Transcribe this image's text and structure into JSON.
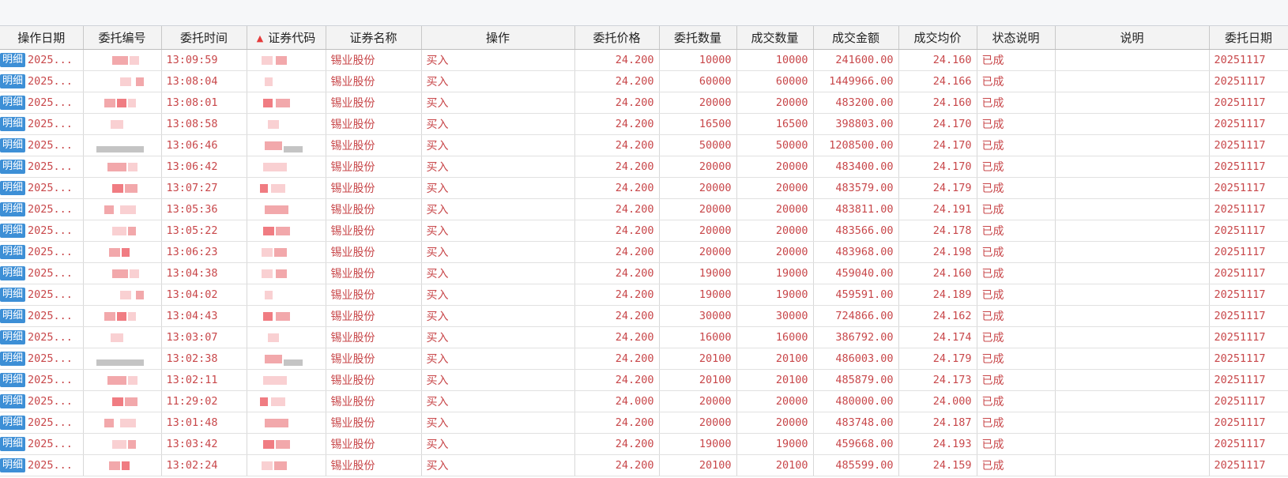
{
  "ui": {
    "detail_label": "明细",
    "sort_arrow": "▲",
    "sort_column": "code"
  },
  "colors": {
    "text_red": "#c8474a",
    "detail_button": "#3d8fd6",
    "header_bg": "#f3f3f3"
  },
  "columns": [
    {
      "key": "op_date",
      "label": "操作日期"
    },
    {
      "key": "entrust_no",
      "label": "委托编号"
    },
    {
      "key": "time",
      "label": "委托时间"
    },
    {
      "key": "code",
      "label": "证券代码"
    },
    {
      "key": "name",
      "label": "证券名称"
    },
    {
      "key": "action",
      "label": "操作"
    },
    {
      "key": "price",
      "label": "委托价格"
    },
    {
      "key": "qty",
      "label": "委托数量"
    },
    {
      "key": "filled_qty",
      "label": "成交数量"
    },
    {
      "key": "amount",
      "label": "成交金额"
    },
    {
      "key": "avg_price",
      "label": "成交均价"
    },
    {
      "key": "status",
      "label": "状态说明"
    },
    {
      "key": "note",
      "label": "说明"
    },
    {
      "key": "entrust_date",
      "label": "委托日期"
    }
  ],
  "rows": [
    {
      "op_date": "2025...",
      "time": "13:09:59",
      "name": "锡业股份",
      "action": "买入",
      "price": "24.200",
      "qty": "10000",
      "filled_qty": "10000",
      "amount": "241600.00",
      "avg_price": "24.160",
      "status": "已成",
      "note": "",
      "entrust_date": "20251117"
    },
    {
      "op_date": "2025...",
      "time": "13:08:04",
      "name": "锡业股份",
      "action": "买入",
      "price": "24.200",
      "qty": "60000",
      "filled_qty": "60000",
      "amount": "1449966.00",
      "avg_price": "24.166",
      "status": "已成",
      "note": "",
      "entrust_date": "20251117"
    },
    {
      "op_date": "2025...",
      "time": "13:08:01",
      "name": "锡业股份",
      "action": "买入",
      "price": "24.200",
      "qty": "20000",
      "filled_qty": "20000",
      "amount": "483200.00",
      "avg_price": "24.160",
      "status": "已成",
      "note": "",
      "entrust_date": "20251117"
    },
    {
      "op_date": "2025...",
      "time": "13:08:58",
      "name": "锡业股份",
      "action": "买入",
      "price": "24.200",
      "qty": "16500",
      "filled_qty": "16500",
      "amount": "398803.00",
      "avg_price": "24.170",
      "status": "已成",
      "note": "",
      "entrust_date": "20251117"
    },
    {
      "op_date": "2025...",
      "time": "13:06:46",
      "name": "锡业股份",
      "action": "买入",
      "price": "24.200",
      "qty": "50000",
      "filled_qty": "50000",
      "amount": "1208500.00",
      "avg_price": "24.170",
      "status": "已成",
      "note": "",
      "entrust_date": "20251117"
    },
    {
      "op_date": "2025...",
      "time": "13:06:42",
      "name": "锡业股份",
      "action": "买入",
      "price": "24.200",
      "qty": "20000",
      "filled_qty": "20000",
      "amount": "483400.00",
      "avg_price": "24.170",
      "status": "已成",
      "note": "",
      "entrust_date": "20251117"
    },
    {
      "op_date": "2025...",
      "time": "13:07:27",
      "name": "锡业股份",
      "action": "买入",
      "price": "24.200",
      "qty": "20000",
      "filled_qty": "20000",
      "amount": "483579.00",
      "avg_price": "24.179",
      "status": "已成",
      "note": "",
      "entrust_date": "20251117"
    },
    {
      "op_date": "2025...",
      "time": "13:05:36",
      "name": "锡业股份",
      "action": "买入",
      "price": "24.200",
      "qty": "20000",
      "filled_qty": "20000",
      "amount": "483811.00",
      "avg_price": "24.191",
      "status": "已成",
      "note": "",
      "entrust_date": "20251117"
    },
    {
      "op_date": "2025...",
      "time": "13:05:22",
      "name": "锡业股份",
      "action": "买入",
      "price": "24.200",
      "qty": "20000",
      "filled_qty": "20000",
      "amount": "483566.00",
      "avg_price": "24.178",
      "status": "已成",
      "note": "",
      "entrust_date": "20251117"
    },
    {
      "op_date": "2025...",
      "time": "13:06:23",
      "name": "锡业股份",
      "action": "买入",
      "price": "24.200",
      "qty": "20000",
      "filled_qty": "20000",
      "amount": "483968.00",
      "avg_price": "24.198",
      "status": "已成",
      "note": "",
      "entrust_date": "20251117"
    },
    {
      "op_date": "2025...",
      "time": "13:04:38",
      "name": "锡业股份",
      "action": "买入",
      "price": "24.200",
      "qty": "19000",
      "filled_qty": "19000",
      "amount": "459040.00",
      "avg_price": "24.160",
      "status": "已成",
      "note": "",
      "entrust_date": "20251117"
    },
    {
      "op_date": "2025...",
      "time": "13:04:02",
      "name": "锡业股份",
      "action": "买入",
      "price": "24.200",
      "qty": "19000",
      "filled_qty": "19000",
      "amount": "459591.00",
      "avg_price": "24.189",
      "status": "已成",
      "note": "",
      "entrust_date": "20251117"
    },
    {
      "op_date": "2025...",
      "time": "13:04:43",
      "name": "锡业股份",
      "action": "买入",
      "price": "24.200",
      "qty": "30000",
      "filled_qty": "30000",
      "amount": "724866.00",
      "avg_price": "24.162",
      "status": "已成",
      "note": "",
      "entrust_date": "20251117"
    },
    {
      "op_date": "2025...",
      "time": "13:03:07",
      "name": "锡业股份",
      "action": "买入",
      "price": "24.200",
      "qty": "16000",
      "filled_qty": "16000",
      "amount": "386792.00",
      "avg_price": "24.174",
      "status": "已成",
      "note": "",
      "entrust_date": "20251117"
    },
    {
      "op_date": "2025...",
      "time": "13:02:38",
      "name": "锡业股份",
      "action": "买入",
      "price": "24.200",
      "qty": "20100",
      "filled_qty": "20100",
      "amount": "486003.00",
      "avg_price": "24.179",
      "status": "已成",
      "note": "",
      "entrust_date": "20251117"
    },
    {
      "op_date": "2025...",
      "time": "13:02:11",
      "name": "锡业股份",
      "action": "买入",
      "price": "24.200",
      "qty": "20100",
      "filled_qty": "20100",
      "amount": "485879.00",
      "avg_price": "24.173",
      "status": "已成",
      "note": "",
      "entrust_date": "20251117"
    },
    {
      "op_date": "2025...",
      "time": "11:29:02",
      "name": "锡业股份",
      "action": "买入",
      "price": "24.000",
      "qty": "20000",
      "filled_qty": "20000",
      "amount": "480000.00",
      "avg_price": "24.000",
      "status": "已成",
      "note": "",
      "entrust_date": "20251117"
    },
    {
      "op_date": "2025...",
      "time": "13:01:48",
      "name": "锡业股份",
      "action": "买入",
      "price": "24.200",
      "qty": "20000",
      "filled_qty": "20000",
      "amount": "483748.00",
      "avg_price": "24.187",
      "status": "已成",
      "note": "",
      "entrust_date": "20251117"
    },
    {
      "op_date": "2025...",
      "time": "13:03:42",
      "name": "锡业股份",
      "action": "买入",
      "price": "24.200",
      "qty": "19000",
      "filled_qty": "19000",
      "amount": "459668.00",
      "avg_price": "24.193",
      "status": "已成",
      "note": "",
      "entrust_date": "20251117"
    },
    {
      "op_date": "2025...",
      "time": "13:02:24",
      "name": "锡业股份",
      "action": "买入",
      "price": "24.200",
      "qty": "20100",
      "filled_qty": "20100",
      "amount": "485599.00",
      "avg_price": "24.159",
      "status": "已成",
      "note": "",
      "entrust_date": "20251117"
    }
  ]
}
